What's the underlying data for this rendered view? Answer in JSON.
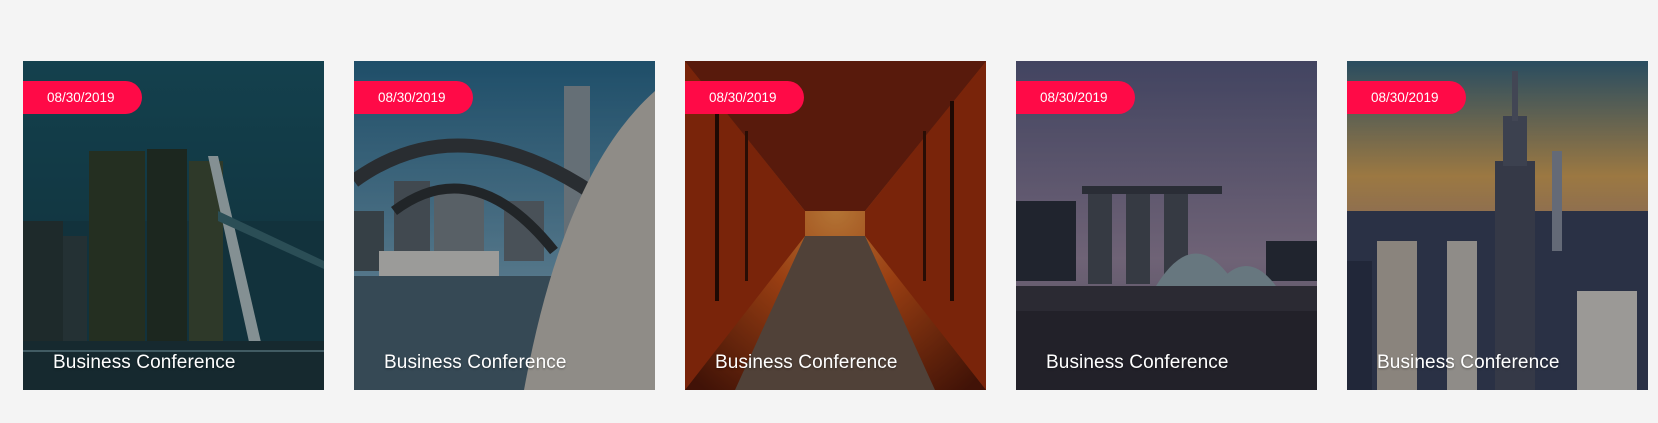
{
  "accent_color": "#ff0a47",
  "cards": [
    {
      "date": "08/30/2019",
      "title": "Business Conference",
      "scene": "rotterdam-bridge"
    },
    {
      "date": "08/30/2019",
      "title": "Business Conference",
      "scene": "toronto-sign"
    },
    {
      "date": "08/30/2019",
      "title": "Business Conference",
      "scene": "torii-gates"
    },
    {
      "date": "08/30/2019",
      "title": "Business Conference",
      "scene": "singapore-skyline"
    },
    {
      "date": "08/30/2019",
      "title": "Business Conference",
      "scene": "new-york-skyline"
    }
  ]
}
